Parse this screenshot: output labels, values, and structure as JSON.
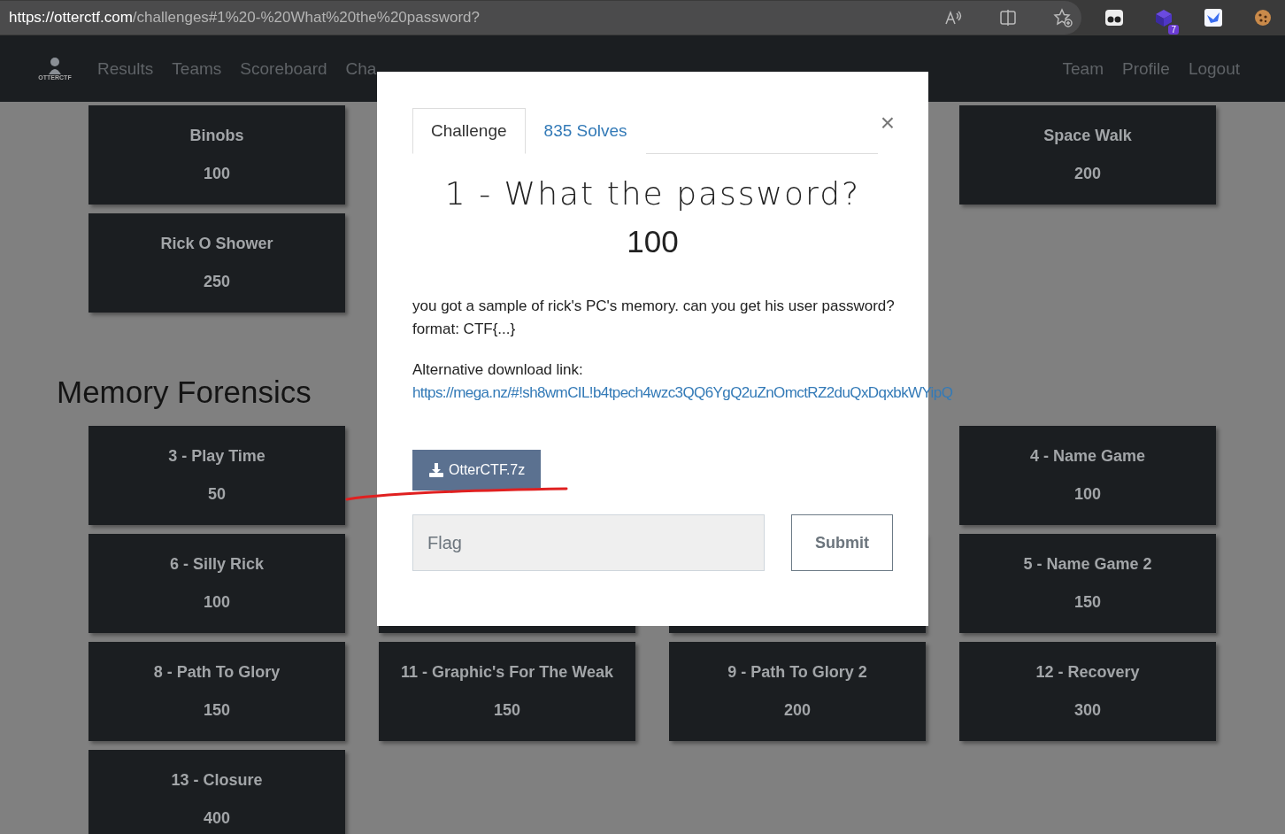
{
  "browser": {
    "url_host": "https://otterctf.com",
    "url_path": "/challenges#1%20-%20What%20the%20password?",
    "extension_badge": "7"
  },
  "navbar": {
    "logo_text": "OTTERCTF",
    "left_links": [
      "Results",
      "Teams",
      "Scoreboard",
      "Cha"
    ],
    "right_links": [
      "Team",
      "Profile",
      "Logout"
    ]
  },
  "sections": [
    {
      "rows": [
        [
          {
            "kind": "card",
            "name": "Binobs",
            "points": "100"
          },
          {
            "kind": "hidden"
          },
          {
            "kind": "hidden"
          },
          {
            "kind": "card",
            "name": "Space Walk",
            "points": "200"
          }
        ],
        [
          {
            "kind": "card",
            "name": "Rick O Shower",
            "points": "250"
          }
        ]
      ]
    },
    {
      "title": "Memory Forensics",
      "rows": [
        [
          {
            "kind": "card",
            "name": "3 - Play Time",
            "points": "50"
          },
          {
            "kind": "hidden"
          },
          {
            "kind": "hidden"
          },
          {
            "kind": "card",
            "name": "4 - Name Game",
            "points": "100"
          }
        ],
        [
          {
            "kind": "card",
            "name": "6 - Silly Rick",
            "points": "100"
          },
          {
            "kind": "covered"
          },
          {
            "kind": "covered"
          },
          {
            "kind": "card",
            "name": "5 - Name Game 2",
            "points": "150"
          }
        ],
        [
          {
            "kind": "card",
            "name": "8 - Path To Glory",
            "points": "150"
          },
          {
            "kind": "card",
            "name": "11 - Graphic's For The Weak",
            "points": "150"
          },
          {
            "kind": "card",
            "name": "9 - Path To Glory 2",
            "points": "200"
          },
          {
            "kind": "card",
            "name": "12 - Recovery",
            "points": "300"
          }
        ],
        [
          {
            "kind": "card",
            "name": "13 - Closure",
            "points": "400"
          }
        ]
      ]
    }
  ],
  "modal": {
    "tabs": [
      {
        "label": "Challenge",
        "selected": true
      },
      {
        "label": "835 Solves",
        "selected": false
      }
    ],
    "close": "×",
    "title": "1 - What the password?",
    "points": "100",
    "description": [
      "you got a sample of rick's PC's memory. can you get his user password?",
      "format: CTF{...}"
    ],
    "alt_label": "Alternative download link:",
    "alt_link": "https://mega.nz/#!sh8wmCIL!b4tpech4wzc3QQ6YgQ2uZnOmctRZ2duQxDqxbkWYipQ",
    "file_button": "OtterCTF.7z",
    "flag": {
      "placeholder": "Flag"
    },
    "submit": "Submit"
  }
}
